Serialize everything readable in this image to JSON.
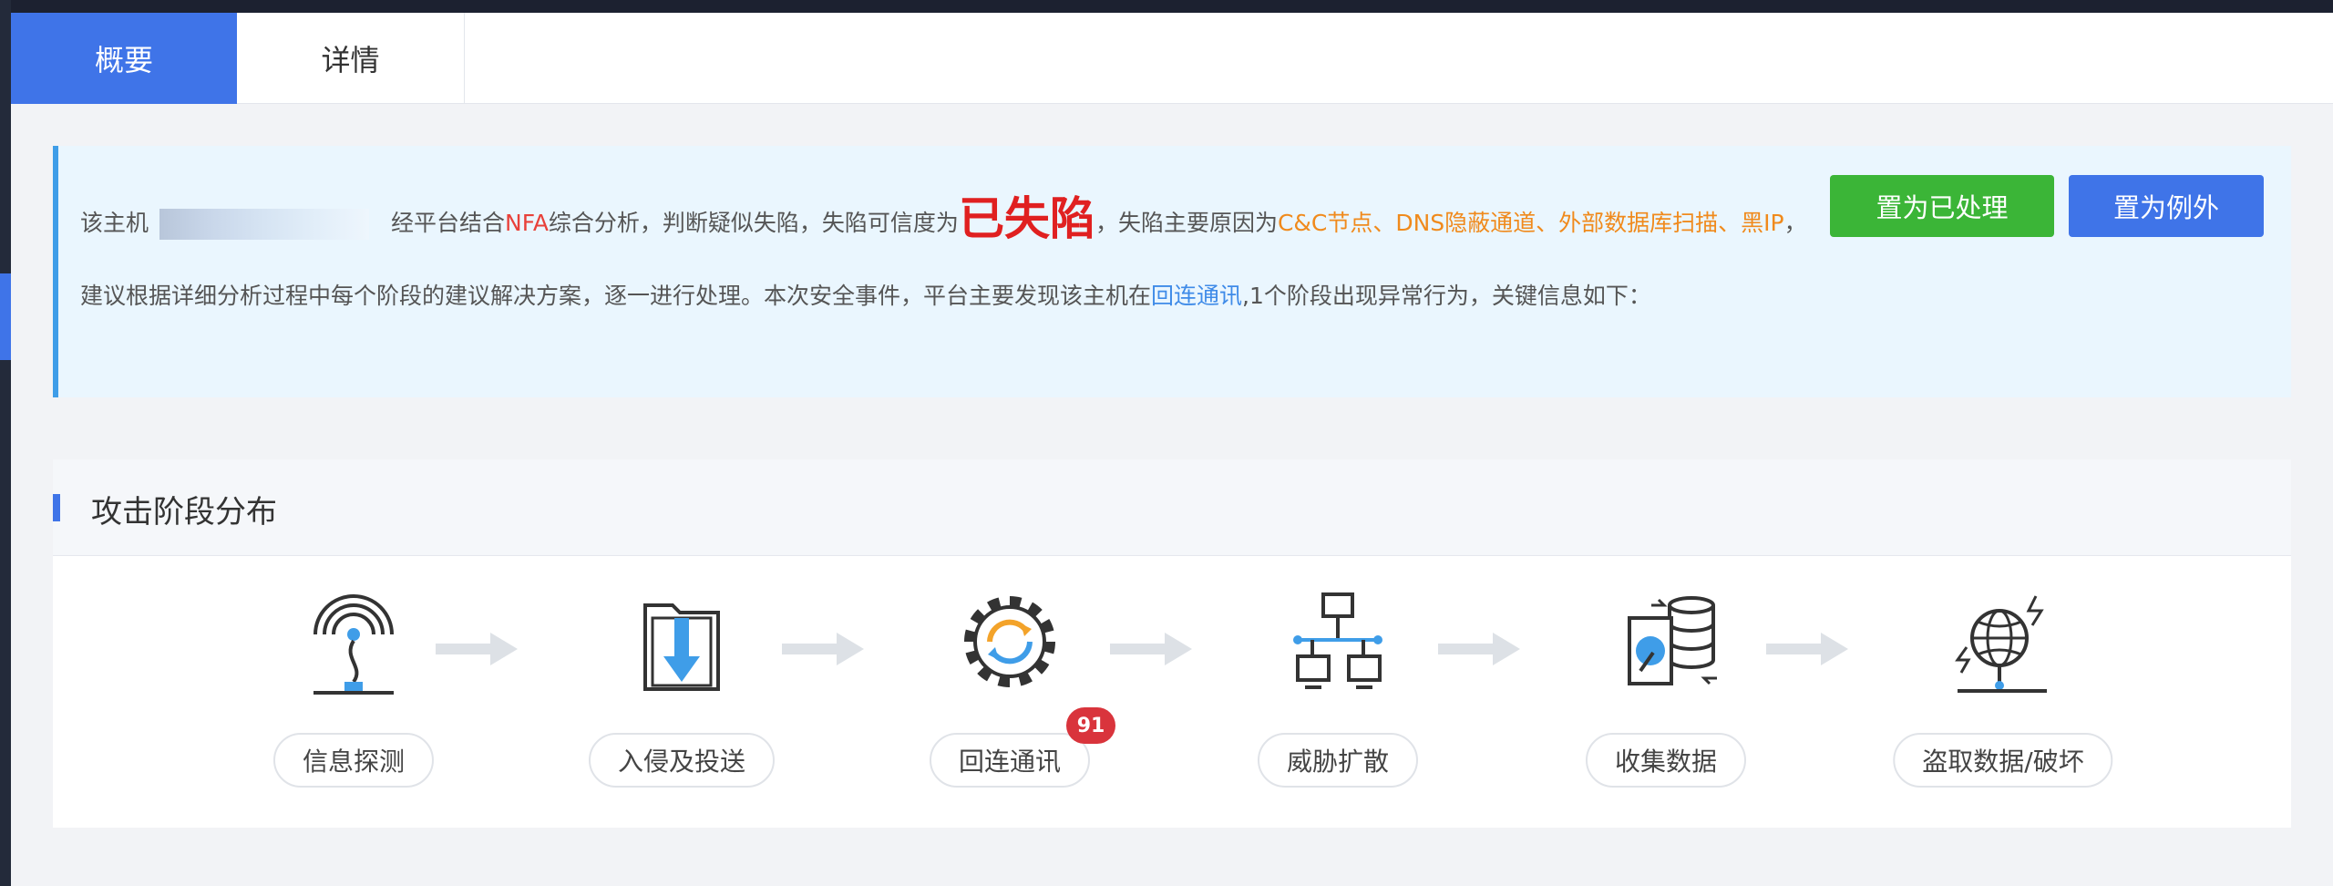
{
  "tabs": [
    {
      "label": "概要",
      "active": true
    },
    {
      "label": "详情",
      "active": false
    }
  ],
  "summary": {
    "host_prefix": "该主机",
    "seg_1": "经平台结合",
    "nfa": "NFA",
    "seg_2": "综合分析，判断疑似失陷，失陷可信度为",
    "verdict": "已失陷",
    "seg_3": "，失陷主要原因为",
    "reasons": "C&C节点、DNS隐蔽通道、外部数据库扫描、黑IP",
    "seg_4": "，建议根据详细分析过程中每个阶段的建议解决方案，逐一进行处理。本次安全事件，平台主要发现该主机在",
    "stage_link": "回连通讯",
    "seg_5": ",1个阶段出现异常行为，关键信息如下：",
    "colors": {
      "verdict": "#e02020",
      "reasons": "#f08a1c",
      "link": "#3f8be8",
      "nfa": "#e8413a"
    }
  },
  "actions": {
    "mark_handled": "置为已处理",
    "mark_exception": "置为例外"
  },
  "stages_section": {
    "title": "攻击阶段分布",
    "stages": [
      {
        "label": "信息探测",
        "icon": "signal-probe-icon",
        "badge": null
      },
      {
        "label": "入侵及投送",
        "icon": "folder-download-icon",
        "badge": null
      },
      {
        "label": "回连通讯",
        "icon": "gear-sync-icon",
        "badge": "91"
      },
      {
        "label": "威胁扩散",
        "icon": "network-topology-icon",
        "badge": null
      },
      {
        "label": "收集数据",
        "icon": "database-collect-icon",
        "badge": null
      },
      {
        "label": "盗取数据/破坏",
        "icon": "globe-attack-icon",
        "badge": null
      }
    ]
  }
}
